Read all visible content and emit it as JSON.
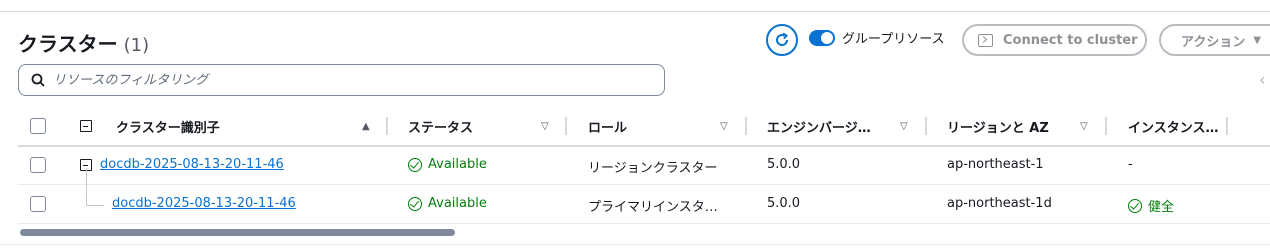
{
  "header": {
    "title": "クラスター",
    "count": "(1)",
    "toggle_label": "グループリソース",
    "connect_label": "Connect to cluster",
    "action_label": "アクション",
    "action_caret": "▼"
  },
  "search": {
    "placeholder": "リソースのフィルタリング"
  },
  "table": {
    "columns": [
      {
        "label": "クラスター識別子",
        "sort": "▲"
      },
      {
        "label": "ステータス",
        "sort": "▽"
      },
      {
        "label": "ロール",
        "sort": "▽"
      },
      {
        "label": "エンジンバージ…",
        "sort": "▽"
      },
      {
        "label": "リージョンと AZ",
        "sort": "▽"
      },
      {
        "label": "インスタンス…",
        "sort": ""
      }
    ],
    "rows": [
      {
        "identifier": "docdb-2025-08-13-20-11-46",
        "status": "Available",
        "role": "リージョンクラスター",
        "engine": "5.0.0",
        "region": "ap-northeast-1",
        "instance": "-"
      },
      {
        "identifier": "docdb-2025-08-13-20-11-46",
        "status": "Available",
        "role": "プライマリインスタ…",
        "engine": "5.0.0",
        "region": "ap-northeast-1d",
        "instance": "健全"
      }
    ]
  },
  "colors": {
    "accent": "#0972d3",
    "success": "#037f0c"
  }
}
